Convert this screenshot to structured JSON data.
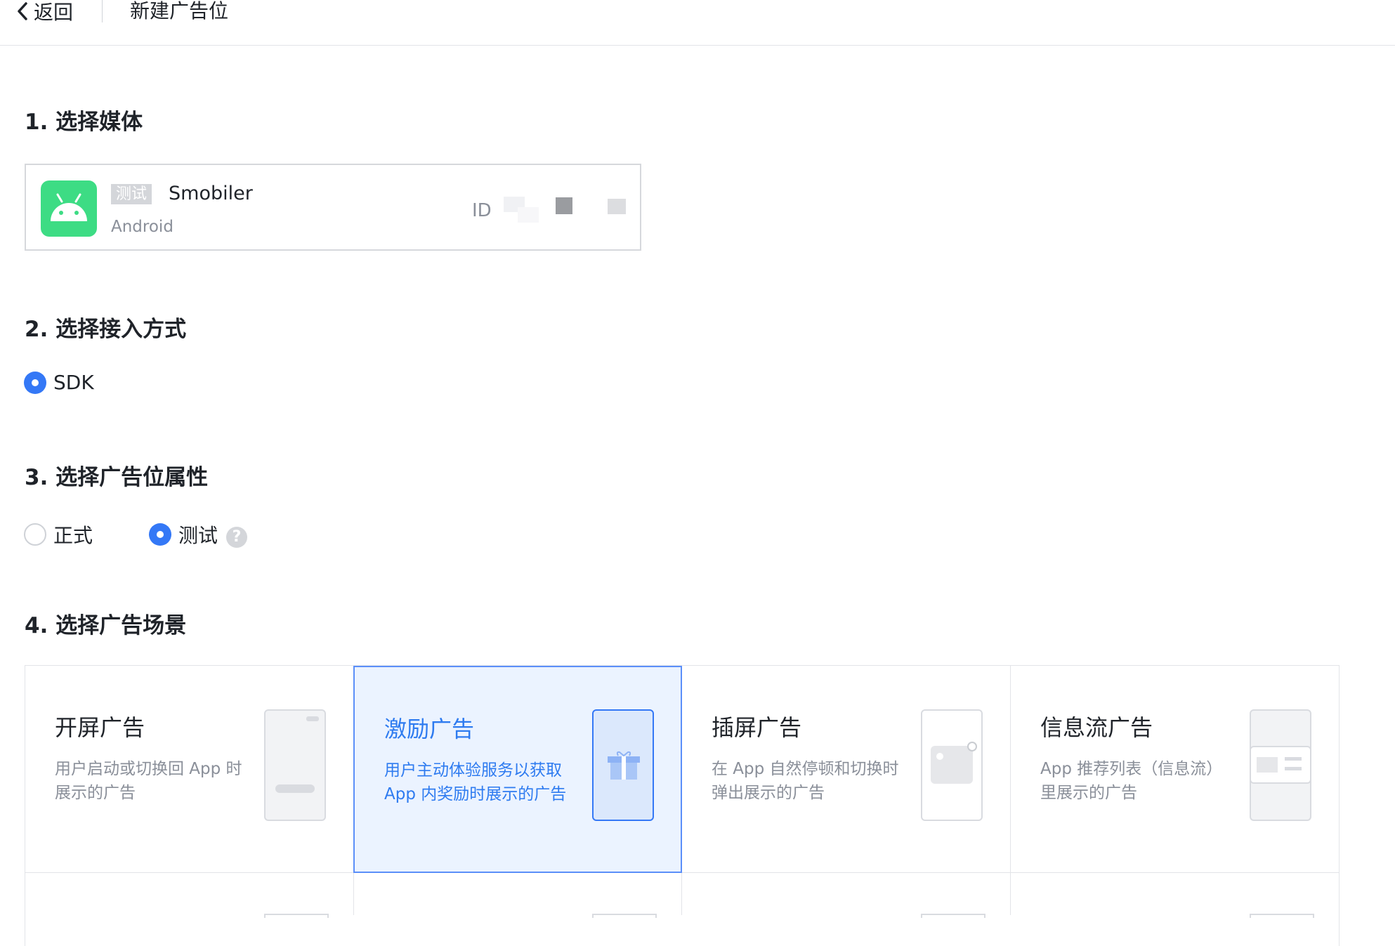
{
  "header": {
    "back_label": "返回",
    "title": "新建广告位"
  },
  "sections": {
    "media": "1. 选择媒体",
    "access": "2. 选择接入方式",
    "attribute": "3. 选择广告位属性",
    "scene": "4. 选择广告场景"
  },
  "media_card": {
    "tag": "测试",
    "app_name": "Smobiler",
    "platform": "Android",
    "id_label": "ID",
    "icon": "android-icon"
  },
  "access_options": [
    {
      "label": "SDK",
      "checked": true
    }
  ],
  "attribute_options": [
    {
      "label": "正式",
      "checked": false
    },
    {
      "label": "测试",
      "checked": true
    }
  ],
  "help_icon": "?",
  "scenes": [
    {
      "title": "开屏广告",
      "desc": "用户启动或切换回 App 时展示的广告",
      "selected": false,
      "icon": "splash-phone-icon"
    },
    {
      "title": "激励广告",
      "desc": "用户主动体验服务以获取 App 内奖励时展示的广告",
      "selected": true,
      "icon": "gift-phone-icon"
    },
    {
      "title": "插屏广告",
      "desc": "在 App 自然停顿和切换时弹出展示的广告",
      "selected": false,
      "icon": "interstitial-phone-icon"
    },
    {
      "title": "信息流广告",
      "desc": "App 推荐列表（信息流）里展示的广告",
      "selected": false,
      "icon": "feed-phone-icon"
    }
  ],
  "colors": {
    "accent": "#3478f6",
    "selected_bg": "#ebf3ff",
    "android_green": "#3ddc84"
  }
}
